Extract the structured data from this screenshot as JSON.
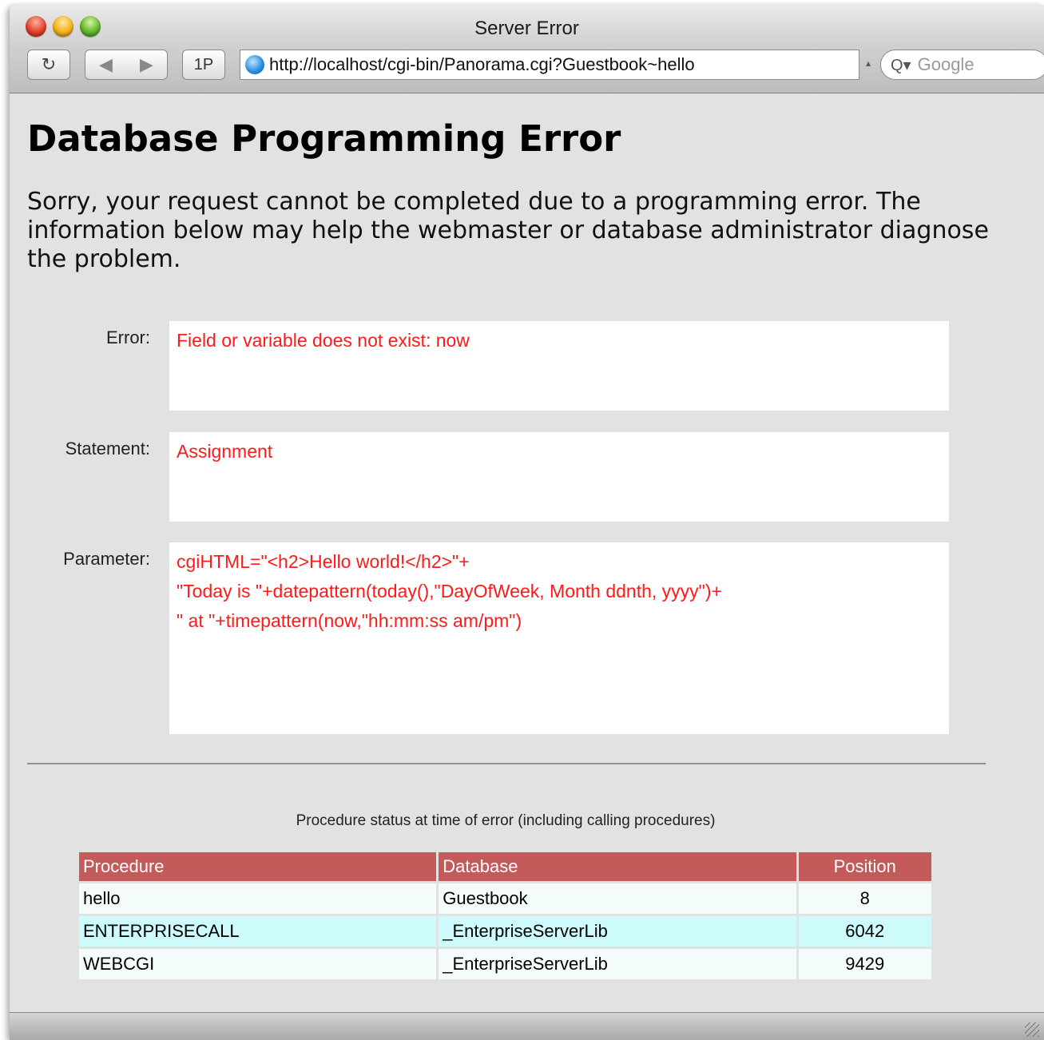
{
  "window": {
    "title": "Server Error"
  },
  "toolbar": {
    "reload_icon": "↻",
    "back_icon": "◀",
    "forward_icon": "▶",
    "onep_label": "1P",
    "url": "http://localhost/cgi-bin/Panorama.cgi?Guestbook~hello",
    "search_icon": "Q▾",
    "search_placeholder": "Google"
  },
  "page": {
    "heading": "Database Programming Error",
    "intro": "Sorry, your request cannot be completed due to a programming error. The information below may help the webmaster or database administrator diagnose the problem."
  },
  "fields": {
    "error": {
      "label": "Error:",
      "value": "Field or variable does not exist: now"
    },
    "statement": {
      "label": "Statement:",
      "value": "Assignment"
    },
    "parameter": {
      "label": "Parameter:",
      "lines": [
        "cgiHTML=\"<h2>Hello world!</h2>\"+",
        "\"Today is \"+datepattern(today(),\"DayOfWeek, Month ddnth, yyyy\")+",
        "\" at \"+timepattern(now,\"hh:mm:ss am/pm\")"
      ]
    }
  },
  "procedure_status": {
    "caption": "Procedure status at time of error (including calling procedures)",
    "columns": [
      "Procedure",
      "Database",
      "Position"
    ],
    "rows": [
      [
        "hello",
        "Guestbook",
        "8"
      ],
      [
        "ENTERPRISECALL",
        "_EnterpriseServerLib",
        "6042"
      ],
      [
        "WEBCGI",
        "_EnterpriseServerLib",
        "9429"
      ]
    ]
  },
  "colors": {
    "error_text": "#ff1a1a",
    "table_header": "#c45a5a",
    "row_highlight": "#cdfbfb"
  }
}
